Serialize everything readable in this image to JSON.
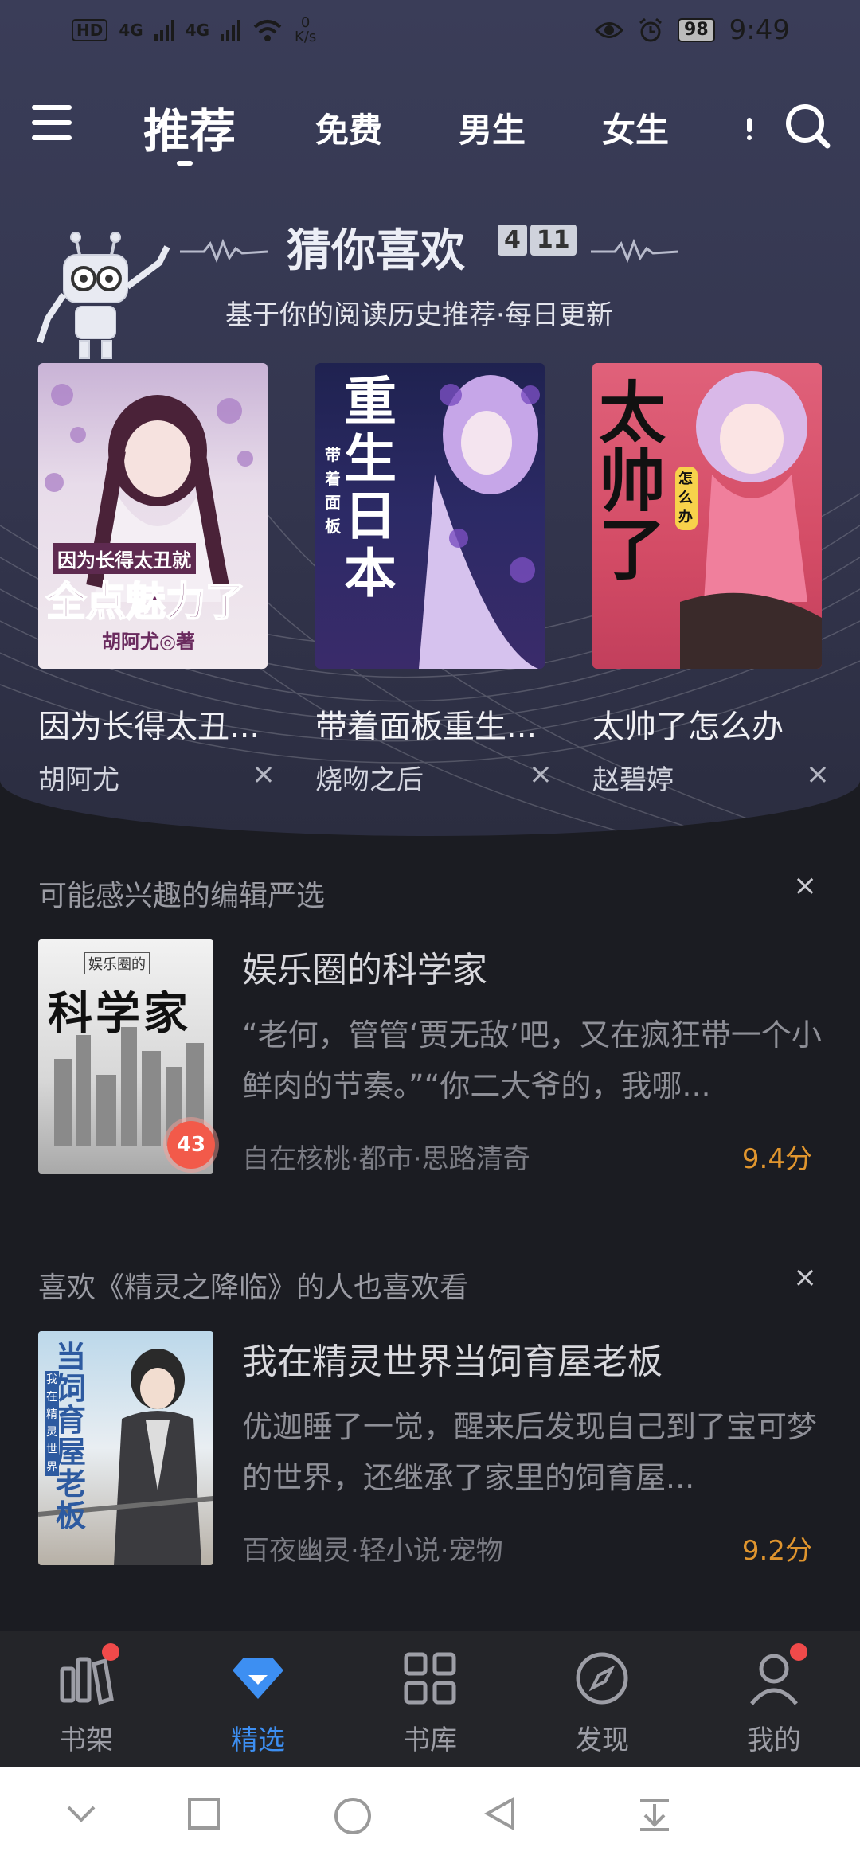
{
  "status": {
    "left_badges": [
      "HD",
      "4G",
      "4G"
    ],
    "speed": "0",
    "speed_unit": "K/s",
    "battery": "98",
    "time": "9:49"
  },
  "tabs": [
    {
      "label": "推荐",
      "active": true
    },
    {
      "label": "免费"
    },
    {
      "label": "男生"
    },
    {
      "label": "女生"
    }
  ],
  "recommend": {
    "title": "猜你喜欢",
    "date_month": "4",
    "date_day": "11",
    "subtitle": "基于你的阅读历史推荐·每日更新",
    "books": [
      {
        "title": "因为长得太丑...",
        "author": "胡阿尤",
        "cover_text": "全点魅力了",
        "cover_top": "因为长得太丑就",
        "cover_author": "胡阿尤◎著",
        "bg": "#e9dfeb"
      },
      {
        "title": "带着面板重生...",
        "author": "烧吻之后",
        "cover_text": "重生日本",
        "cover_side": "带着面板",
        "bg": "#2a2a5a"
      },
      {
        "title": "太帅了怎么办",
        "author": "赵碧婷",
        "cover_text": "太帅了",
        "cover_side": "怎么办",
        "bg": "#d8566e"
      }
    ],
    "close": "×"
  },
  "sections": [
    {
      "heading": "可能感兴趣的编辑严选",
      "close": "×",
      "book": {
        "title": "娱乐圈的科学家",
        "desc": "“老何，管管‘贾无敌’吧，又在疯狂带一个小鲜肉的节奏。”“你二大爷的，我哪...",
        "meta": "自在核桃·都市·思路清奇",
        "score": "9.4分",
        "badge": "43",
        "cover_text": "科学家",
        "cover_top": "娱乐圈的"
      }
    },
    {
      "heading": "喜欢《精灵之降临》的人也喜欢看",
      "close": "×",
      "book": {
        "title": "我在精灵世界当饲育屋老板",
        "desc": "优迦睡了一觉，醒来后发现自己到了宝可梦的世界，还继承了家里的饲育屋...",
        "meta": "百夜幽灵·轻小说·宠物",
        "score": "9.2分",
        "cover_text": "当饲育屋老板",
        "cover_side": "我在精灵世界"
      }
    }
  ],
  "bottom_nav": [
    {
      "label": "书架",
      "icon": "bookshelf-icon",
      "dot": true
    },
    {
      "label": "精选",
      "icon": "diamond-icon",
      "active": true
    },
    {
      "label": "书库",
      "icon": "grid-icon"
    },
    {
      "label": "发现",
      "icon": "compass-icon"
    },
    {
      "label": "我的",
      "icon": "user-icon",
      "dot": true
    }
  ],
  "colors": {
    "accent": "#3d8ff2",
    "score": "#e0952e",
    "dot": "#f04a4a"
  }
}
